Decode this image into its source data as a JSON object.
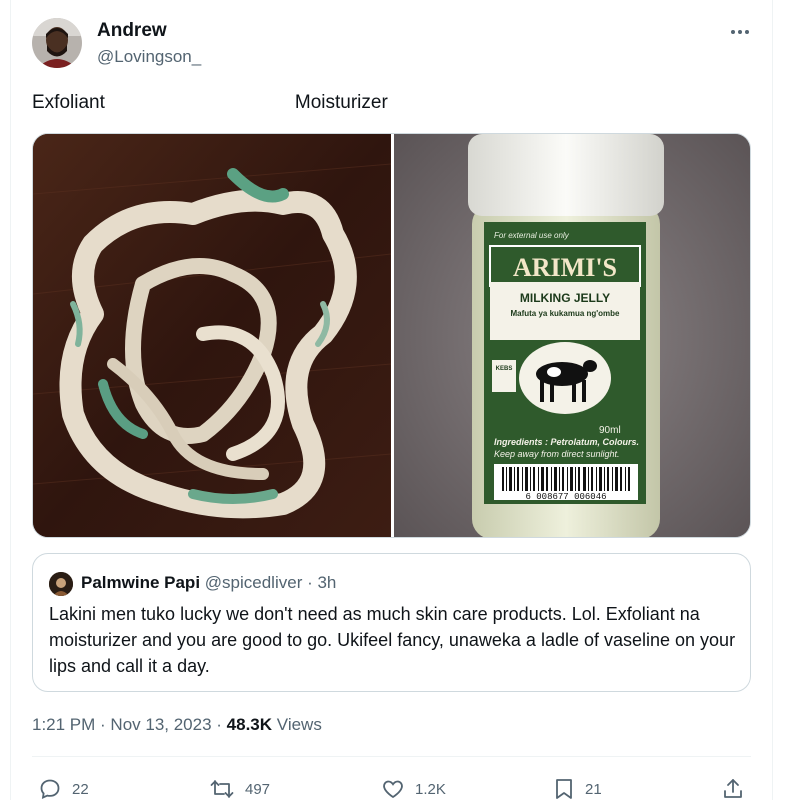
{
  "author": {
    "name": "Andrew",
    "handle": "@Lovingson_"
  },
  "tweet": {
    "label_left": "Exfoliant",
    "label_right": "Moisturizer"
  },
  "media": {
    "left_image": "pile of worn, shredded white and green cloth on a dark wooden surface",
    "right_image": "jar of milking jelly on grey carpet",
    "jar": {
      "top_note": "For external use only",
      "brand": "ARIMI'S",
      "product": "MILKING JELLY",
      "subtitle": "Mafuta ya kukamua ng'ombe",
      "kebs": "KEBS",
      "volume": "90ml",
      "ingredients": "Ingredients : Petrolatum, Colours.",
      "warning": "Keep away from direct sunlight.",
      "barcode": "6 008677 006046"
    }
  },
  "quote": {
    "name": "Palmwine Papi",
    "handle": "@spicedliver",
    "time": "3h",
    "body": "Lakini men tuko lucky we don't need as much skin care products. Lol. Exfoliant na moisturizer and you are good to go. Ukifeel fancy, unaweka a ladle of vaseline on your lips and call it a day."
  },
  "meta": {
    "time": "1:21 PM",
    "date": "Nov 13, 2023",
    "views": "48.3K",
    "views_label": "Views"
  },
  "actions": {
    "replies": "22",
    "reposts": "497",
    "likes": "1.2K",
    "bookmarks": "21"
  },
  "colors": {
    "secondary_text": "#536471",
    "border": "#cfd9de",
    "jar_green": "#2f5a2c"
  }
}
